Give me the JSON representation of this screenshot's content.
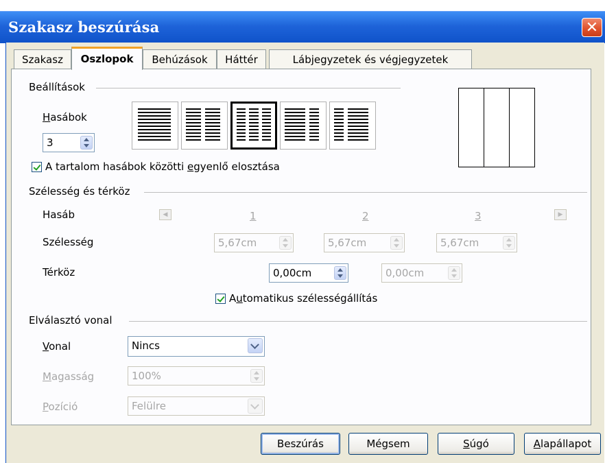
{
  "window": {
    "title": "Szakasz beszúrása",
    "close_icon": "close-icon"
  },
  "tabs": [
    {
      "label": "Szakasz",
      "active": false
    },
    {
      "label": "Oszlopok",
      "active": true
    },
    {
      "label": "Behúzások",
      "active": false
    },
    {
      "label": "Háttér",
      "active": false
    },
    {
      "label": "Lábjegyzetek és végjegyzetek",
      "active": false
    }
  ],
  "settings": {
    "section_label": "Beállítások",
    "columns_label_u": "H",
    "columns_label_rest": "asábok",
    "columns_value": "3",
    "presets_selected_index": 2,
    "equal_distribution_checked": true,
    "equal_distribution_pre": "A tartalom hasábok közötti ",
    "equal_distribution_u": "e",
    "equal_distribution_post": "gyenlő elosztása"
  },
  "width_spacing": {
    "section_label": "Szélesség és térköz",
    "column_label": "Hasáb",
    "width_label": "Szélesség",
    "spacing_label": "Térköz",
    "column_numbers": [
      "1",
      "2",
      "3"
    ],
    "widths": [
      "5,67cm",
      "5,67cm",
      "5,67cm"
    ],
    "spacings": [
      "0,00cm",
      "0,00cm"
    ],
    "auto_width_checked": true,
    "auto_width_pre": "A",
    "auto_width_u": "u",
    "auto_width_post": "tomatikus szélességállítás"
  },
  "separator": {
    "section_label": "Elválasztó vonal",
    "line_label_u": "V",
    "line_label_rest": "onal",
    "line_value": "Nincs",
    "height_label_u": "M",
    "height_label_rest": "agasság",
    "height_value": "100%",
    "position_label_u": "P",
    "position_label_rest": "ozíció",
    "position_value": "Felülre"
  },
  "buttons": {
    "insert": "Beszúrás",
    "cancel": "Mégsem",
    "help_u": "S",
    "help_rest": "úgó",
    "reset_u": "A",
    "reset_rest": "lapállapot"
  },
  "colors": {
    "titlebar": "#1e63d9",
    "tab_highlight": "#f0a227",
    "check": "#21a121"
  }
}
